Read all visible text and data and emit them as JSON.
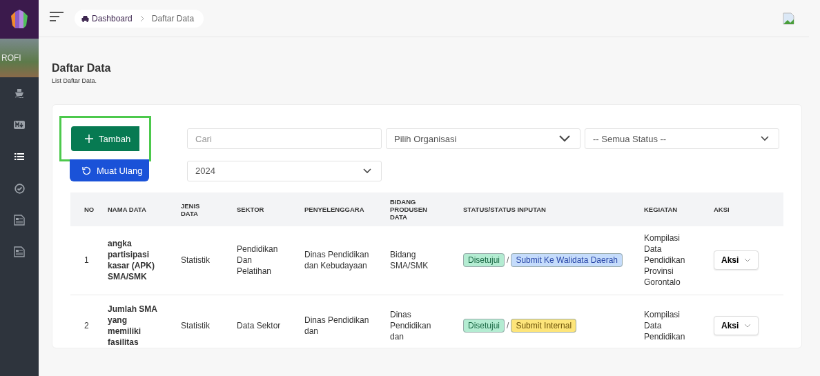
{
  "sidebar": {
    "items": [
      {
        "kind": "ship",
        "selected": false
      },
      {
        "kind": "markdown",
        "selected": false
      },
      {
        "kind": "list",
        "selected": true
      },
      {
        "kind": "check",
        "selected": false
      },
      {
        "kind": "newspaper",
        "selected": false
      },
      {
        "kind": "newspaper",
        "selected": false
      }
    ]
  },
  "banner": {
    "text": "ROFI"
  },
  "breadcrumb": [
    {
      "label": "Dashboard",
      "kind": "link"
    },
    {
      "label": "Daftar Data",
      "kind": "current"
    }
  ],
  "page": {
    "title": "Daftar Data",
    "subtitle": "List Daftar Data."
  },
  "toolbar": {
    "add_button": {
      "label": "Tambah",
      "highlighted": true
    },
    "reload_button": {
      "label": "Muat Ulang"
    },
    "search": {
      "placeholder": "Cari"
    },
    "organization": {
      "value": "Pilih Organisasi"
    },
    "status": {
      "value": "-- Semua Status --"
    },
    "year": {
      "value": "2024"
    }
  },
  "table": {
    "columns": [
      "NO",
      "NAMA DATA",
      "JENIS DATA",
      "SEKTOR",
      "PENYELENGGARA",
      "BIDANG PRODUSEN DATA",
      "STATUS/STATUS INPUTAN",
      "KEGIATAN",
      "AKSI"
    ],
    "rows": [
      {
        "no": "1",
        "nama_data": "angka partisipasi kasar (APK) SMA/SMK",
        "jenis_data": "Statistik",
        "sektor": "Pendidikan Dan Pelatihan",
        "penyelenggara": "Dinas Pendidikan dan Kebudayaan",
        "bidang": "Bidang SMA/SMK",
        "status_separator": "/",
        "status": [
          {
            "label": "Disetujui",
            "color": "#b4ecd2"
          },
          {
            "label": "Submit Ke Walidata Daerah",
            "color": "#c5dcfb"
          }
        ],
        "kegiatan": "Kompilasi Data Pendidikan Provinsi Gorontalo",
        "aksi": "Aksi"
      },
      {
        "no": "2",
        "nama_data": "Jumlah SMA yang memiliki fasilitas",
        "jenis_data": "Statistik",
        "sektor": "Data Sektor",
        "penyelenggara": "Dinas Pendidikan dan",
        "bidang": "Dinas Pendidikan dan",
        "status_separator": "/",
        "status": [
          {
            "label": "Disetujui",
            "color": "#b4ecd2"
          },
          {
            "label": "Submit Internal",
            "color": "#fde57a"
          }
        ],
        "kegiatan": "Kompilasi Data Pendidikan",
        "aksi": "Aksi"
      }
    ]
  }
}
